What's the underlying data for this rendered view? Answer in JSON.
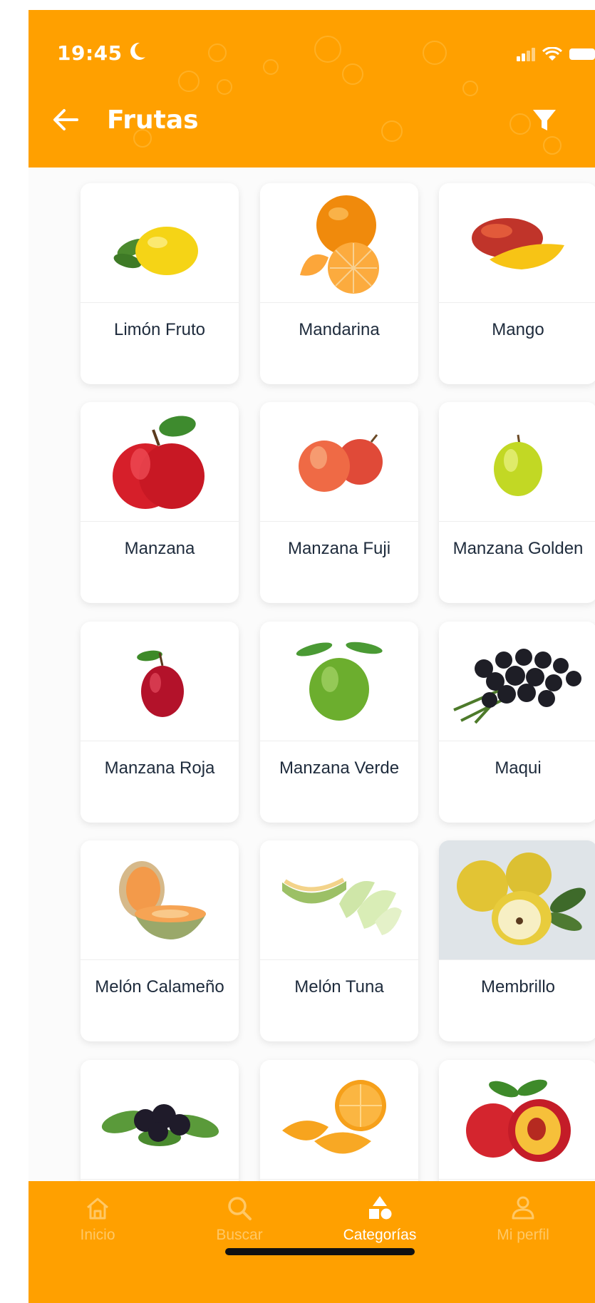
{
  "status_bar": {
    "time": "19:45"
  },
  "header": {
    "title": "Frutas",
    "background": "#ffa000"
  },
  "products": [
    {
      "name": "Limón Fruto",
      "icon": "lemon"
    },
    {
      "name": "Mandarina",
      "icon": "mandarin"
    },
    {
      "name": "Mango",
      "icon": "mango"
    },
    {
      "name": "Manzana",
      "icon": "red-apple"
    },
    {
      "name": "Manzana Fuji",
      "icon": "fuji-apples"
    },
    {
      "name": "Manzana Golden",
      "icon": "golden-apple"
    },
    {
      "name": "Manzana Roja",
      "icon": "small-red-apple"
    },
    {
      "name": "Manzana Verde",
      "icon": "green-apple"
    },
    {
      "name": "Maqui",
      "icon": "maqui-berries"
    },
    {
      "name": "Melón Calameño",
      "icon": "cantaloupe"
    },
    {
      "name": "Melón Tuna",
      "icon": "honeydew-slices"
    },
    {
      "name": "Membrillo",
      "icon": "quince"
    },
    {
      "name": "",
      "icon": "blackberries"
    },
    {
      "name": "",
      "icon": "orange-slices"
    },
    {
      "name": "",
      "icon": "nectarine"
    }
  ],
  "tabbar": {
    "tabs": [
      {
        "label": "Inicio",
        "icon": "home-icon",
        "active": false
      },
      {
        "label": "Buscar",
        "icon": "search-icon",
        "active": false
      },
      {
        "label": "Categorías",
        "icon": "categories-icon",
        "active": true
      },
      {
        "label": "Mi perfil",
        "icon": "profile-icon",
        "active": false
      }
    ]
  }
}
